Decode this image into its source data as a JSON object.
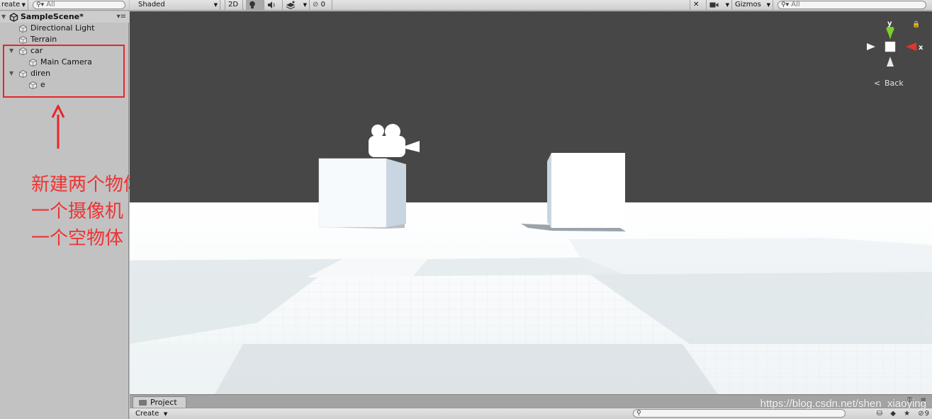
{
  "hierarchy": {
    "create_label": "reate",
    "search_placeholder": "All",
    "scene_name": "SampleScene*",
    "items": [
      {
        "label": "Directional Light"
      },
      {
        "label": "Terrain"
      },
      {
        "label": "car"
      },
      {
        "label": "Main Camera"
      },
      {
        "label": "diren"
      },
      {
        "label": "e"
      }
    ]
  },
  "annotation": {
    "line1": "新建两个物体",
    "line2": "一个摄像机",
    "line3": "一个空物体（Empty）",
    "color": "#ee3333"
  },
  "scene_toolbar": {
    "shading_mode": "Shaded",
    "mode_2d": "2D",
    "hidden_count": "0",
    "gizmos_label": "Gizmos",
    "search_placeholder": "All"
  },
  "gizmo": {
    "y_label": "y",
    "x_label": "x",
    "back_label": "Back"
  },
  "project": {
    "tab_label": "Project",
    "create_label": "Create",
    "layer_count": "9"
  },
  "watermark": "https://blog.csdn.net/shen_xiaoying",
  "colors": {
    "sky": "#474747",
    "ground": "#f5f8fa",
    "highlight": "#e8242a",
    "gizmo_y": "#7dd02b",
    "gizmo_x": "#e0352b"
  }
}
